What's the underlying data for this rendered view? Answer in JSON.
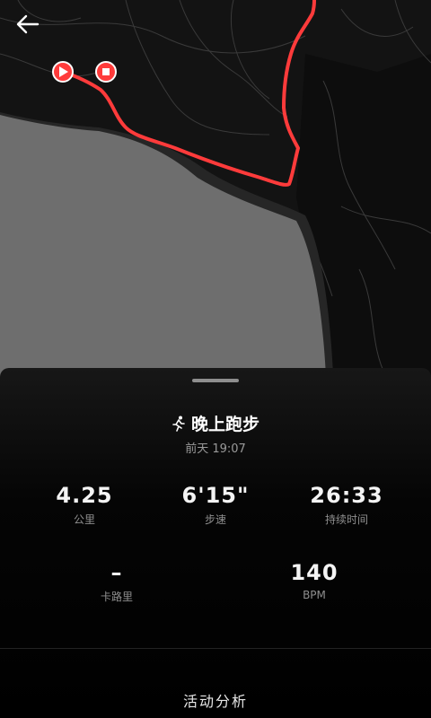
{
  "activity": {
    "title": "晚上跑步",
    "time": "前天 19:07",
    "icon": "running-person-icon"
  },
  "stats": [
    {
      "key": "distance",
      "value": "4.25",
      "label": "公里"
    },
    {
      "key": "pace",
      "value": "6'15\"",
      "label": "步速"
    },
    {
      "key": "duration",
      "value": "26:33",
      "label": "持续时间"
    },
    {
      "key": "calories",
      "value": "–",
      "label": "卡路里"
    },
    {
      "key": "heart_rate",
      "value": "140",
      "label": "BPM"
    }
  ],
  "footer": {
    "analysis_label": "活动分析"
  },
  "colors": {
    "route": "#ff3b3b",
    "start_marker": "#ff3b3b",
    "end_marker": "#ff3b3b",
    "water": "#6e6e6e"
  },
  "icons": {
    "back": "arrow-left-icon",
    "start": "play-icon",
    "end": "stop-icon"
  }
}
